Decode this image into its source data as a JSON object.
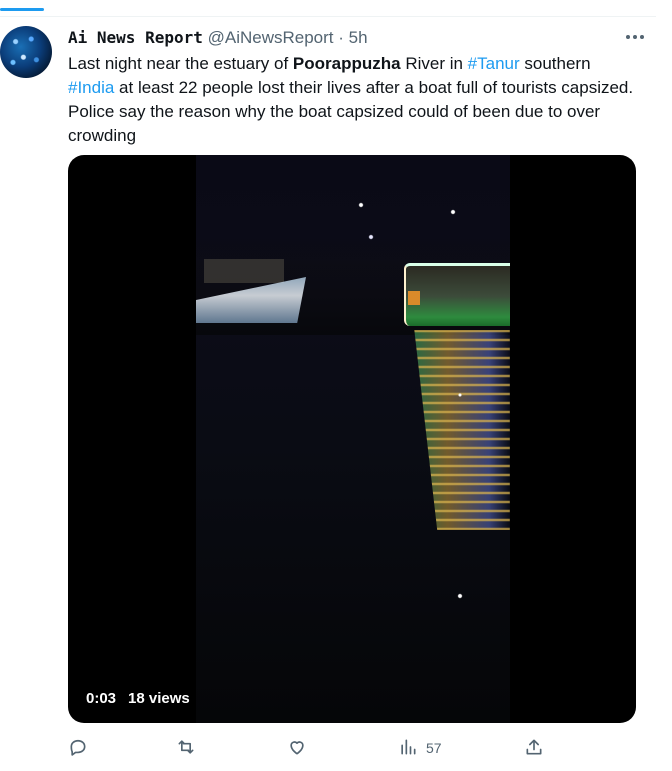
{
  "tweet": {
    "author_name": "Ai News Report",
    "handle": "@AiNewsReport",
    "separator": "·",
    "time": "5h",
    "text": {
      "p1": "Last night near the estuary of ",
      "bold": "Poorappuzha",
      "p2": " River in ",
      "hashtag1": "#Tanur",
      "p3": " southern ",
      "hashtag2": "#India",
      "p4": " at least 22 people lost their lives after a boat full of tourists capsized. Police say the reason why the boat capsized could of been due to over crowding"
    },
    "media": {
      "duration": "0:03",
      "views": "18 views"
    },
    "actions": {
      "reply_count": "",
      "retweet_count": "",
      "like_count": "",
      "views_count": "57"
    }
  },
  "icons": [
    "more-icon",
    "reply-icon",
    "retweet-icon",
    "like-icon",
    "views-icon",
    "share-icon"
  ],
  "colors": {
    "accent": "#1d9bf0",
    "text": "#0f1419",
    "muted": "#536471"
  }
}
